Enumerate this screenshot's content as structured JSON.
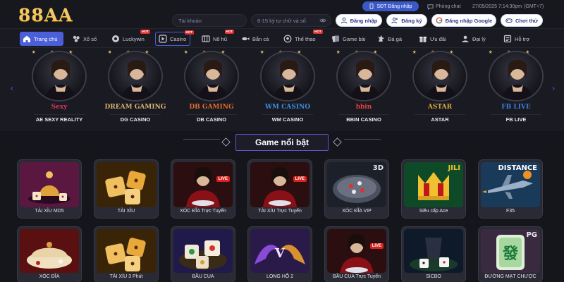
{
  "header": {
    "logo": "88AA",
    "sdt_button": "SĐT Đăng nhập",
    "support_label": "Phòng chat",
    "datetime": "27/05/2025 7:14:30pm",
    "timezone": "(GMT+7)",
    "username_placeholder": "Tài khoản",
    "password_placeholder": "6-15 ký tự chữ và số",
    "login_label": "Đăng nhập",
    "register_label": "Đăng ký",
    "google_login_label": "Đăng nhập Google",
    "play_trial_label": "Chơi thử"
  },
  "nav": {
    "items": [
      {
        "label": "Trang chủ",
        "icon": "home-icon"
      },
      {
        "label": "Xổ số",
        "icon": "lottery-icon"
      },
      {
        "label": "Luckywin",
        "icon": "luckywin-icon",
        "badge": "HOT"
      },
      {
        "label": "Casino",
        "icon": "casino-icon",
        "badge": "HOT"
      },
      {
        "label": "Nổ hũ",
        "icon": "slot-icon",
        "badge": "HOT"
      },
      {
        "label": "Bắn cá",
        "icon": "fish-icon"
      },
      {
        "label": "Thể thao",
        "icon": "sports-icon",
        "badge": "HOT"
      },
      {
        "label": "Game bài",
        "icon": "cards-icon"
      },
      {
        "label": "Đá gà",
        "icon": "rooster-icon"
      },
      {
        "label": "Ưu đãi",
        "icon": "gift-icon"
      },
      {
        "label": "Đại lý",
        "icon": "agent-icon"
      },
      {
        "label": "Hỗ trợ",
        "icon": "support-icon"
      }
    ]
  },
  "providers": [
    {
      "brand": "Sexy",
      "name": "AE SEXY REALITY",
      "color": "#d8345a"
    },
    {
      "brand": "DREAM GAMING",
      "name": "DG CASINO",
      "color": "#d4b070"
    },
    {
      "brand": "DB GAMING",
      "name": "DB CASINO",
      "color": "#e06a2a"
    },
    {
      "brand": "WM CASINO",
      "name": "WM CASINO",
      "color": "#3a8ee0"
    },
    {
      "brand": "bbin",
      "name": "BBIN CASINO",
      "color": "#e0403a"
    },
    {
      "brand": "ASTAR",
      "name": "ASTAR",
      "color": "#d8a640"
    },
    {
      "brand": "FB LIVE",
      "name": "FB LIVE",
      "color": "#3a7ee0"
    }
  ],
  "section": {
    "title": "Game nổi bật"
  },
  "games_row1": [
    {
      "label": "TÀI XỈU MD5",
      "icon": "dice-cup-icon"
    },
    {
      "label": "TÀI XỈU",
      "icon": "dice-icon"
    },
    {
      "label": "XÓC ĐĨA Trực Tuyến",
      "icon": "live-dealer-icon",
      "tag": "LIVE"
    },
    {
      "label": "TÀI XỈU Trực Tuyến",
      "icon": "live-dealer-icon",
      "tag": "LIVE"
    },
    {
      "label": "XÓC ĐĨA VIP",
      "icon": "xoc-dia-icon",
      "tag": "3D"
    },
    {
      "label": "Siêu cấp Ace",
      "icon": "jili-icon",
      "tag": "JILI"
    },
    {
      "label": "F35",
      "icon": "jet-icon",
      "tag": "DISTANCE"
    }
  ],
  "games_row2": [
    {
      "label": "XÓC ĐĨA",
      "icon": "bowl-icon"
    },
    {
      "label": "TÀI XỈU 3 Phút",
      "icon": "dice-icon"
    },
    {
      "label": "BẦU CUA",
      "icon": "bau-cua-icon"
    },
    {
      "label": "LONG HỔ 2",
      "icon": "dragon-tiger-icon"
    },
    {
      "label": "BẦU CUA Trực Tuyến",
      "icon": "live-dealer-icon",
      "tag": "LIVE"
    },
    {
      "label": "SICBO",
      "icon": "sicbo-icon"
    },
    {
      "label": "ĐƯỜNG MẠT CHƯỢC",
      "icon": "mahjong-icon",
      "tag": "PG"
    }
  ]
}
